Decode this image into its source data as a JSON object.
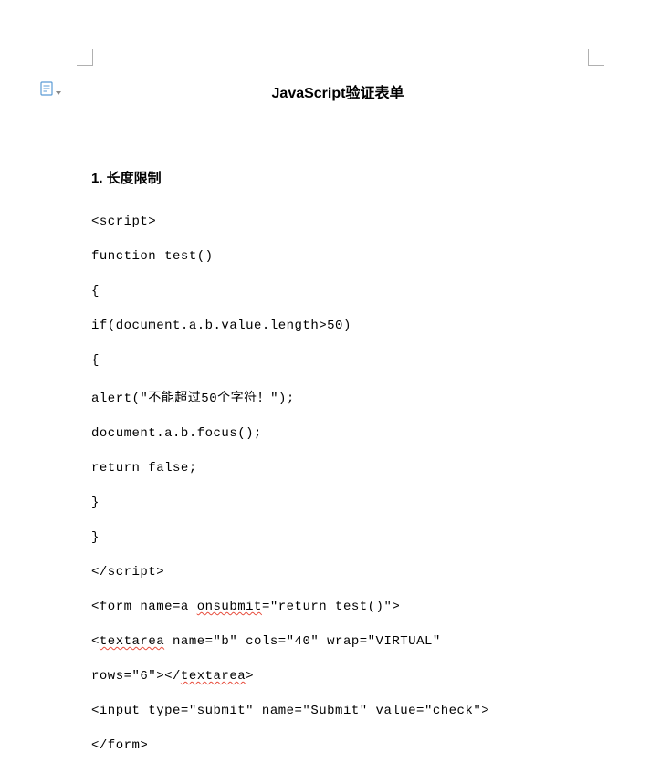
{
  "title": "JavaScript验证表单",
  "section_heading": "1. 长度限制",
  "code_lines": [
    "<script>",
    "function test()",
    "{",
    "if(document.a.b.value.length>50)",
    "{",
    "alert(\"不能超过50个字符！\");",
    "document.a.b.focus();",
    "return false;",
    "}",
    "}",
    "</script>",
    "<form name=a onsubmit=\"return test()\">",
    "<textarea name=\"b\" cols=\"40\" wrap=\"VIRTUAL\"",
    "rows=\"6\"></textarea>",
    "<input type=\"submit\" name=\"Submit\" value=\"check\">",
    "</form>"
  ],
  "misspellings": {
    "11": [
      "onsubmit"
    ],
    "12": [
      "textarea"
    ],
    "13": [
      "textarea"
    ]
  }
}
